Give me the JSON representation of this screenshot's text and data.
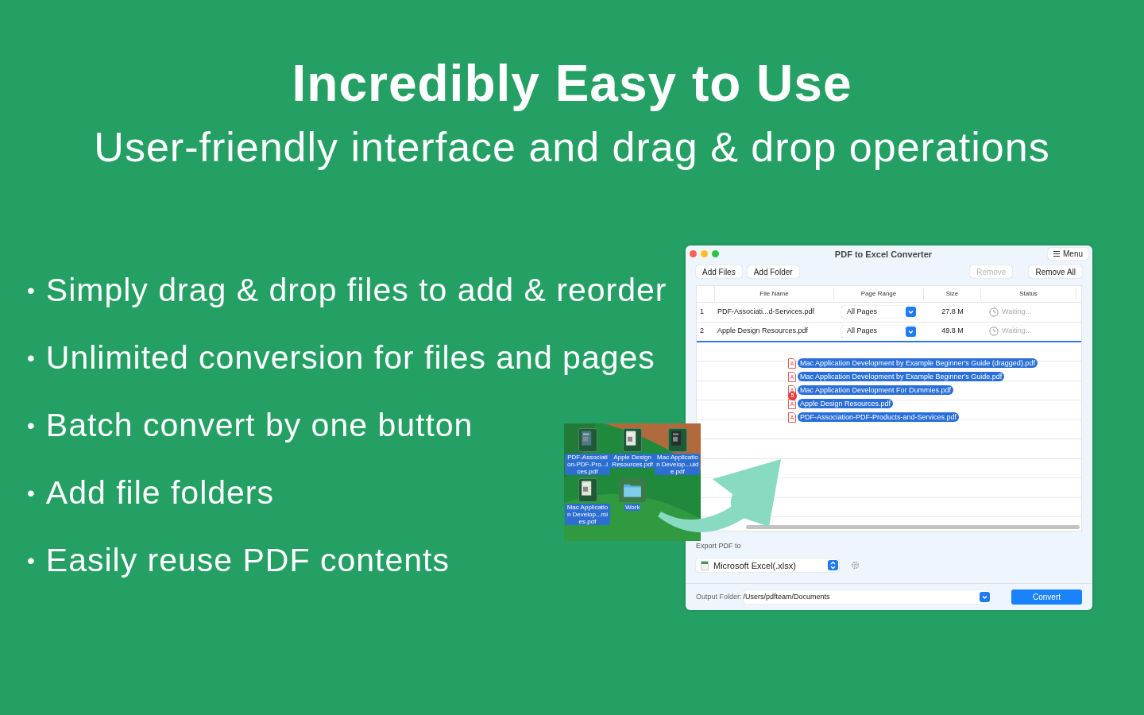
{
  "headline": "Incredibly Easy to Use",
  "subheadline": "User-friendly interface and drag & drop operations",
  "bullets": [
    "Simply drag & drop files to add & reorder",
    "Unlimited conversion for files and pages",
    "Batch convert by one button",
    "Add file folders",
    "Easily reuse PDF contents"
  ],
  "bullet_mark": "•",
  "desktop": {
    "icons": [
      {
        "label": "PDF-Association-PDF-Pro...ices.pdf",
        "kind": "document"
      },
      {
        "label": "Apple Design Resources.pdf",
        "kind": "document"
      },
      {
        "label": "Mac Application Develop...uide.pdf",
        "kind": "document"
      },
      {
        "label": "Mac Application Develop...mies.pdf",
        "kind": "document"
      },
      {
        "label": "Work",
        "kind": "folder"
      }
    ]
  },
  "window": {
    "title": "PDF to Excel Converter",
    "menu_button": "Menu",
    "toolbar_left": [
      {
        "label": "Add Files",
        "disabled": false
      },
      {
        "label": "Add Folder",
        "disabled": false
      }
    ],
    "toolbar_right": [
      {
        "label": "Remove",
        "disabled": true
      },
      {
        "label": "Remove All",
        "disabled": false
      }
    ],
    "table": {
      "columns": [
        "File Name",
        "Page Range",
        "Size",
        "Status"
      ],
      "rows": [
        {
          "index": "1",
          "file_name": "PDF-Associati...d-Services.pdf",
          "page_range": "All Pages",
          "size": "27.8 M",
          "status": "Waiting..."
        },
        {
          "index": "2",
          "file_name": "Apple Design Resources.pdf",
          "page_range": "All Pages",
          "size": "49.8 M",
          "status": "Waiting..."
        }
      ],
      "dragged_files": [
        "Mac Application Development by Example Beginner's Guide (dragged).pdf",
        "Mac Application Development by Example Beginner's Guide.pdf",
        "Mac Application Development For Dummies.pdf",
        "Apple Design Resources.pdf",
        "PDF-Association-PDF-Products-and-Services.pdf"
      ],
      "drag_count": "5"
    },
    "export_label": "Export PDF to",
    "export_format": "Microsoft Excel(.xlsx)",
    "output_label": "Output Folder:",
    "output_path": "/Users/pdfteam/Documents",
    "convert_button": "Convert"
  }
}
